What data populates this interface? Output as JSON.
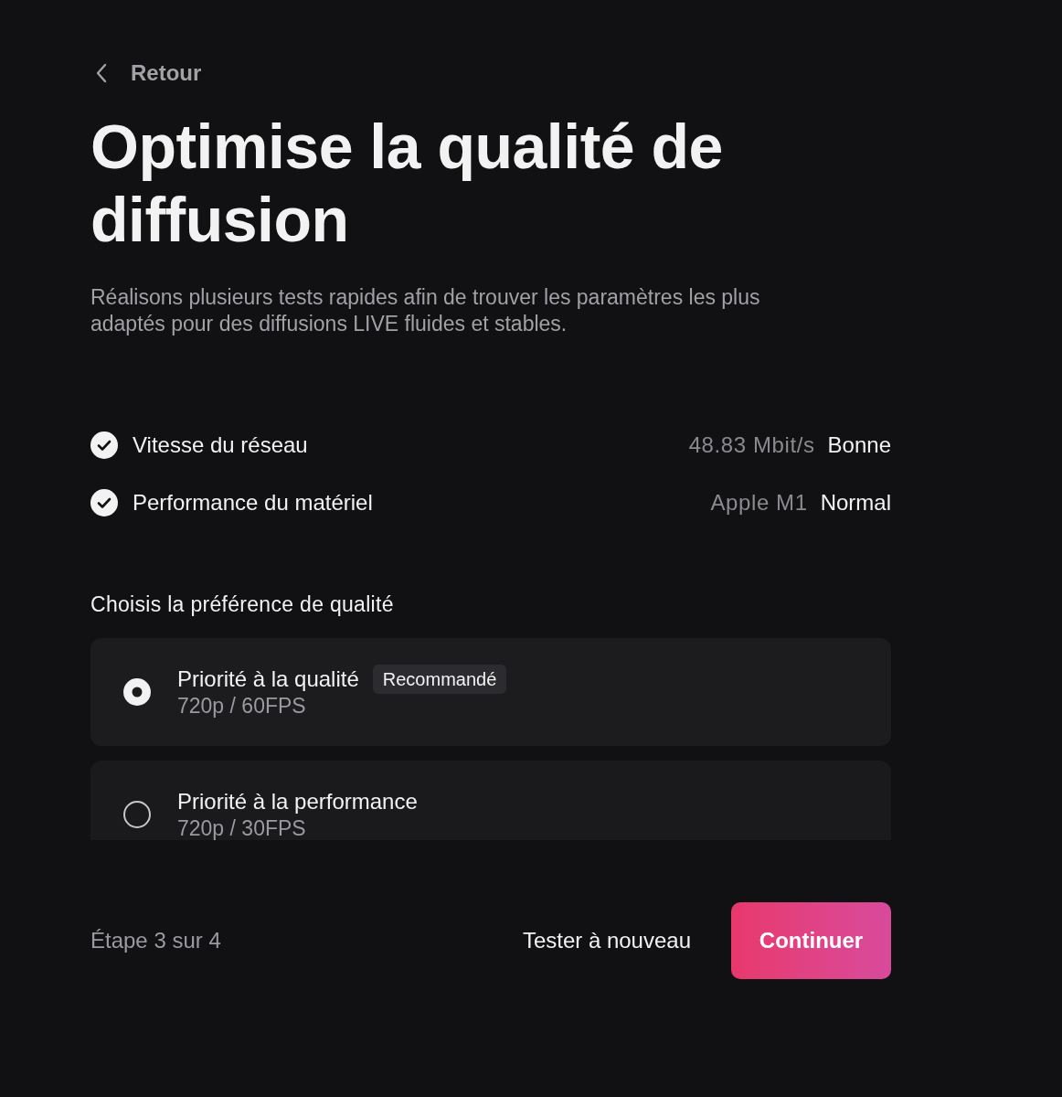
{
  "back": {
    "label": "Retour"
  },
  "title": "Optimise la qualité de diffusion",
  "subtitle": "Réalisons plusieurs tests rapides afin de trouver les paramètres les plus adaptés pour des diffusions LIVE fluides et stables.",
  "checks": [
    {
      "label": "Vitesse du réseau",
      "checked": true,
      "detail": "48.83 Mbit/s",
      "result": "Bonne"
    },
    {
      "label": "Performance du matériel",
      "checked": true,
      "detail": "Apple M1",
      "result": "Normal"
    }
  ],
  "quality": {
    "heading": "Choisis la préférence de qualité",
    "options": [
      {
        "title": "Priorité à la qualité",
        "subtitle": "720p / 60FPS",
        "badge": "Recommandé",
        "selected": true
      },
      {
        "title": "Priorité à la performance",
        "subtitle": "720p / 30FPS",
        "selected": false
      }
    ]
  },
  "footer": {
    "step": "Étape 3 sur 4",
    "buttons": [
      {
        "label": "Tester à nouveau",
        "kind": "text"
      },
      {
        "label": "Continuer",
        "kind": "primary"
      }
    ]
  }
}
